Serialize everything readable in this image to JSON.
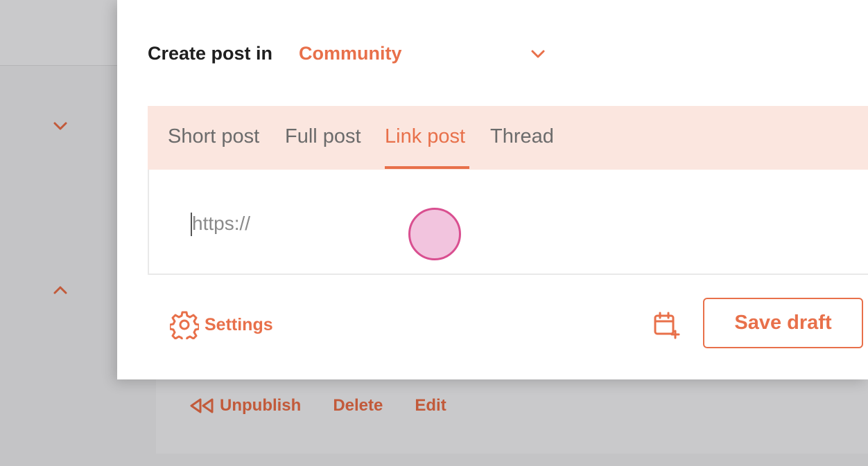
{
  "header": {
    "label": "Create post in",
    "community": "Community"
  },
  "tabs": [
    {
      "label": "Short post"
    },
    {
      "label": "Full post"
    },
    {
      "label": "Link post"
    },
    {
      "label": "Thread"
    }
  ],
  "link": {
    "placeholder": "https://"
  },
  "footer": {
    "settings_label": "Settings",
    "save_label": "Save draft"
  },
  "background": {
    "actions": [
      {
        "label": "Unpublish"
      },
      {
        "label": "Delete"
      },
      {
        "label": "Edit"
      }
    ]
  },
  "colors": {
    "accent": "#e8704a",
    "tab_bar": "#fbe6df",
    "backdrop": "#c4c4c6",
    "cursor": "#d94f90"
  }
}
